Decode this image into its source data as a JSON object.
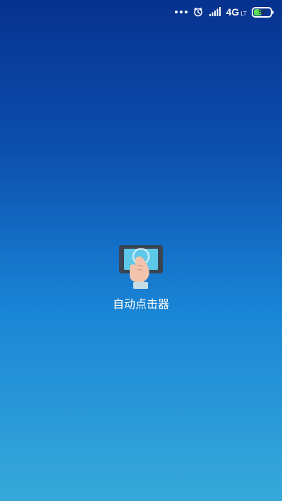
{
  "status_bar": {
    "network": "4G",
    "network_suffix": "LT",
    "battery": 52,
    "battery_label": "52",
    "accent_battery": "#5ce05a"
  },
  "icons": {
    "more": "more-dots-icon",
    "alarm": "alarm-icon",
    "signal": "signal-icon",
    "battery": "battery-icon",
    "app": "tap-phone-icon"
  },
  "app": {
    "name": "自动点击器"
  },
  "colors": {
    "background_top": "#07328f",
    "background_middle": "#1985d6",
    "background_bottom": "#37a9d9",
    "icon_screen": "#5ec8e8",
    "icon_phone": "#3a4452",
    "hand": "#f2c4ad",
    "cuff": "#c6dde5"
  }
}
